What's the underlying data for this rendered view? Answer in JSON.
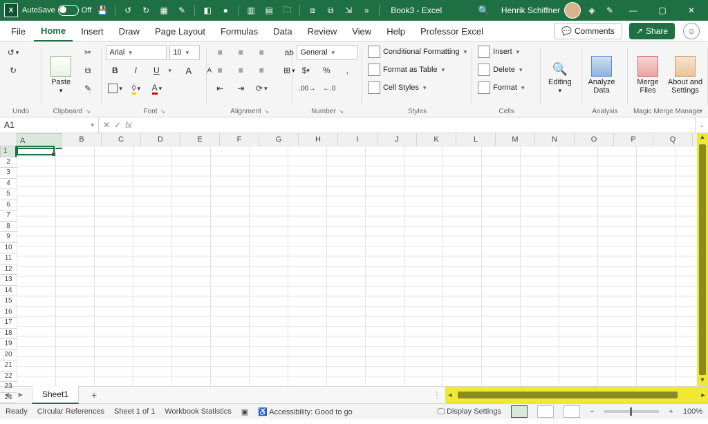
{
  "titlebar": {
    "app": "X",
    "autosave_label": "AutoSave",
    "autosave_state": "Off",
    "doc_title": "Book3 - Excel",
    "user_name": "Henrik Schiffner"
  },
  "menu": {
    "items": [
      "File",
      "Home",
      "Insert",
      "Draw",
      "Page Layout",
      "Formulas",
      "Data",
      "Review",
      "View",
      "Help",
      "Professor Excel"
    ],
    "active": "Home",
    "comments": "Comments",
    "share": "Share"
  },
  "ribbon": {
    "undo": {
      "label": "Undo"
    },
    "clipboard": {
      "paste": "Paste",
      "label": "Clipboard"
    },
    "font": {
      "name": "Arial",
      "size": "10",
      "bold": "B",
      "italic": "I",
      "underline": "U",
      "inc": "A",
      "dec": "A",
      "label": "Font"
    },
    "alignment": {
      "label": "Alignment",
      "wrap": "ab"
    },
    "number": {
      "format": "General",
      "label": "Number"
    },
    "styles": {
      "cond": "Conditional Formatting",
      "table": "Format as Table",
      "cell": "Cell Styles",
      "label": "Styles"
    },
    "cells": {
      "insert": "Insert",
      "delete": "Delete",
      "format": "Format",
      "label": "Cells"
    },
    "editing": {
      "label": "Editing",
      "btn": "Editing"
    },
    "analysis": {
      "btn": "Analyze\nData",
      "label": "Analysis"
    },
    "merge": {
      "btn1": "Merge\nFiles",
      "btn2": "About and\nSettings",
      "label": "Magic Merge Manager"
    }
  },
  "formula_bar": {
    "cell_ref": "A1",
    "fx": "fx"
  },
  "grid": {
    "columns": [
      "A",
      "B",
      "C",
      "D",
      "E",
      "F",
      "G",
      "H",
      "I",
      "J",
      "K",
      "L",
      "M",
      "N",
      "O",
      "P",
      "Q"
    ],
    "rows": [
      "1",
      "2",
      "3",
      "4",
      "5",
      "6",
      "7",
      "8",
      "9",
      "10",
      "11",
      "12",
      "13",
      "14",
      "15",
      "16",
      "17",
      "18",
      "19",
      "20",
      "21",
      "22",
      "23",
      "24"
    ]
  },
  "tabs": {
    "sheet": "Sheet1"
  },
  "status": {
    "ready": "Ready",
    "circ": "Circular References",
    "sheet_count": "Sheet 1 of 1",
    "wbstats": "Workbook Statistics",
    "accessibility": "Accessibility: Good to go",
    "display": "Display Settings",
    "zoom": "100%"
  }
}
